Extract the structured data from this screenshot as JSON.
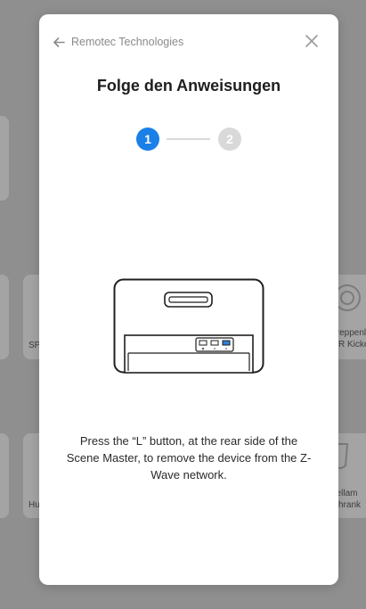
{
  "background": {
    "cards": [
      {
        "name": "bg-card-sp",
        "label": "SP"
      },
      {
        "name": "bg-card-treppen",
        "label1": "Treppenl",
        "label2": "R Kicke"
      },
      {
        "name": "bg-card-hu",
        "label": "Hu"
      },
      {
        "name": "bg-card-gellam",
        "label1": "gellam",
        "label2": "hrank"
      }
    ]
  },
  "modal": {
    "back_label": "Remotec Technologies",
    "title": "Folge den Anweisungen",
    "steps": [
      {
        "number": "1",
        "state": "active"
      },
      {
        "number": "2",
        "state": "inactive"
      }
    ],
    "instruction": "Press the “L” button, at the rear side of the Scene Master, to remove the device from the Z-Wave network."
  },
  "colors": {
    "accent": "#1a7fe6",
    "inactive_step": "#d9d9d9",
    "overlay": "#8f8f8f"
  },
  "icons": {
    "back": "arrow-left-icon",
    "close": "close-icon"
  }
}
